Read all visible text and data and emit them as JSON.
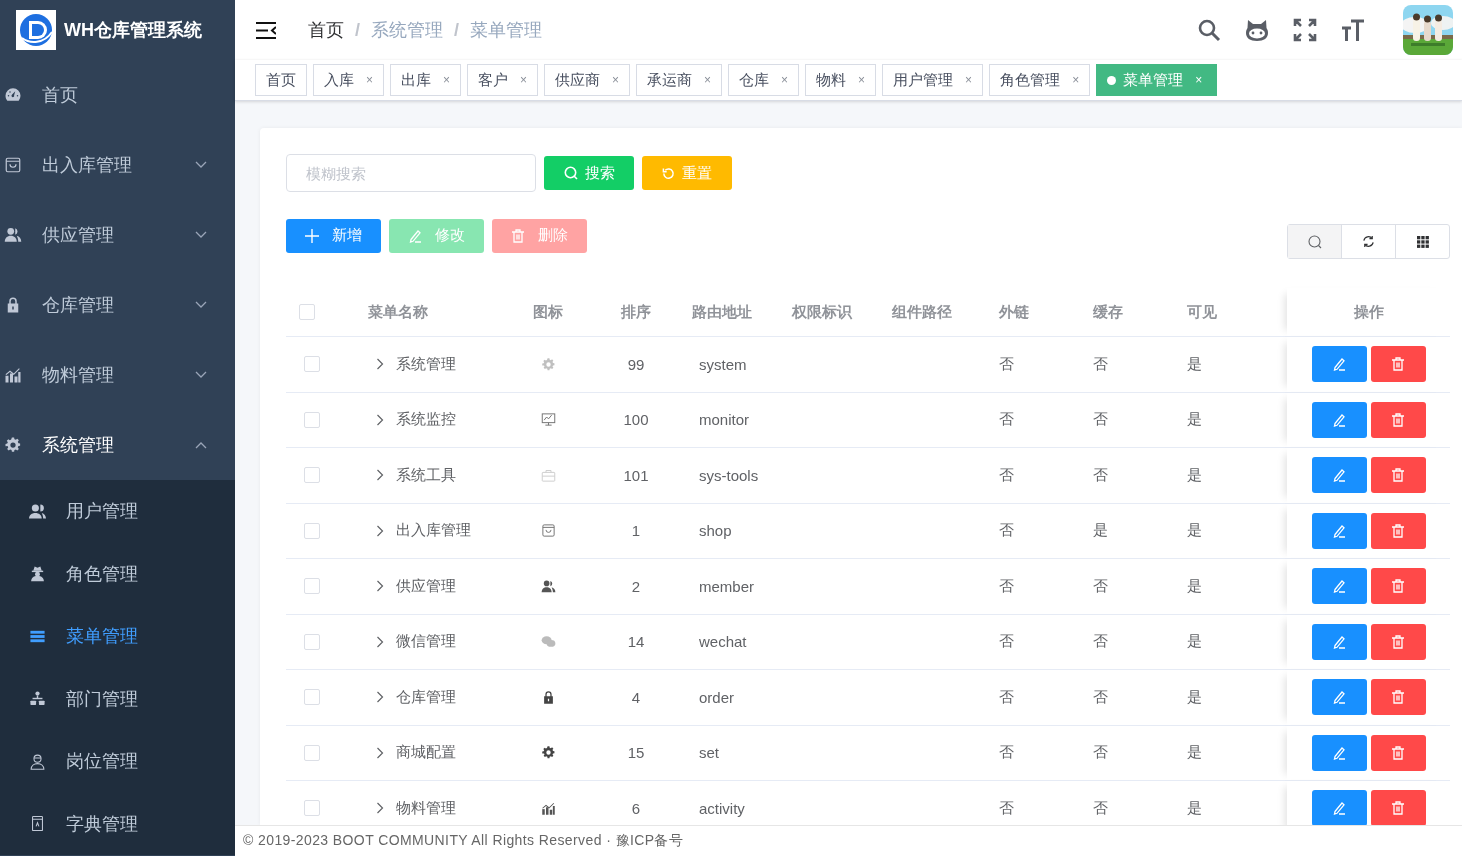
{
  "app": {
    "title": "WH仓库管理系统"
  },
  "sidebar": {
    "items": [
      {
        "label": "首页",
        "kind": "link"
      },
      {
        "label": "出入库管理",
        "kind": "group",
        "expanded": false
      },
      {
        "label": "供应管理",
        "kind": "group",
        "expanded": false
      },
      {
        "label": "仓库管理",
        "kind": "group",
        "expanded": false
      },
      {
        "label": "物料管理",
        "kind": "group",
        "expanded": false
      },
      {
        "label": "系统管理",
        "kind": "group",
        "expanded": true,
        "children": [
          {
            "label": "用户管理",
            "selected": false
          },
          {
            "label": "角色管理",
            "selected": false
          },
          {
            "label": "菜单管理",
            "selected": true
          },
          {
            "label": "部门管理",
            "selected": false
          },
          {
            "label": "岗位管理",
            "selected": false
          },
          {
            "label": "字典管理",
            "selected": false
          }
        ]
      }
    ]
  },
  "header": {
    "breadcrumb": [
      {
        "label": "首页",
        "link": true
      },
      {
        "separator": "/",
        "label": "系统管理",
        "link": false
      },
      {
        "separator": "/",
        "label": "菜单管理",
        "link": false
      }
    ]
  },
  "tags": [
    {
      "label": "首页",
      "selected": false
    },
    {
      "label": "入库",
      "close": "×",
      "selected": false
    },
    {
      "label": "出库",
      "close": "×",
      "selected": false
    },
    {
      "label": "客户",
      "close": "×",
      "selected": false
    },
    {
      "label": "供应商",
      "close": "×",
      "selected": false
    },
    {
      "label": "承运商",
      "close": "×",
      "selected": false
    },
    {
      "label": "仓库",
      "close": "×",
      "selected": false
    },
    {
      "label": "物料",
      "close": "×",
      "selected": false
    },
    {
      "label": "用户管理",
      "close": "×",
      "selected": false
    },
    {
      "label": "角色管理",
      "close": "×",
      "selected": false
    },
    {
      "label": "菜单管理",
      "close": "×",
      "selected": true
    }
  ],
  "search": {
    "placeholder": "模糊搜索",
    "buttons": [
      {
        "label": "搜索",
        "kind": "search"
      },
      {
        "label": "重置",
        "kind": "reset"
      }
    ]
  },
  "actions": [
    {
      "label": "新增",
      "kind": "add",
      "disabled": false
    },
    {
      "label": "修改",
      "kind": "edit",
      "disabled": true
    },
    {
      "label": "删除",
      "kind": "delete",
      "disabled": true
    }
  ],
  "table": {
    "header_checked": false,
    "columns": [
      "菜单名称",
      "图标",
      "排序",
      "路由地址",
      "权限标识",
      "组件路径",
      "外链",
      "缓存",
      "可见",
      "操作"
    ],
    "rows": [
      {
        "checked": false,
        "expanded": false,
        "name": "系统管理",
        "sort": "99",
        "path": "system",
        "external": "否",
        "cache": "否",
        "visible": "是"
      },
      {
        "checked": false,
        "expanded": false,
        "name": "系统监控",
        "sort": "100",
        "path": "monitor",
        "external": "否",
        "cache": "否",
        "visible": "是"
      },
      {
        "checked": false,
        "expanded": false,
        "name": "系统工具",
        "sort": "101",
        "path": "sys-tools",
        "external": "否",
        "cache": "否",
        "visible": "是"
      },
      {
        "checked": false,
        "expanded": false,
        "name": "出入库管理",
        "sort": "1",
        "path": "shop",
        "external": "否",
        "cache": "是",
        "visible": "是"
      },
      {
        "checked": false,
        "expanded": false,
        "name": "供应管理",
        "sort": "2",
        "path": "member",
        "external": "否",
        "cache": "否",
        "visible": "是"
      },
      {
        "checked": false,
        "expanded": false,
        "name": "微信管理",
        "sort": "14",
        "path": "wechat",
        "external": "否",
        "cache": "否",
        "visible": "是"
      },
      {
        "checked": false,
        "expanded": false,
        "name": "仓库管理",
        "sort": "4",
        "path": "order",
        "external": "否",
        "cache": "否",
        "visible": "是"
      },
      {
        "checked": false,
        "expanded": false,
        "name": "商城配置",
        "sort": "15",
        "path": "set",
        "external": "否",
        "cache": "否",
        "visible": "是"
      },
      {
        "checked": false,
        "expanded": false,
        "name": "物料管理",
        "sort": "6",
        "path": "activity",
        "external": "否",
        "cache": "否",
        "visible": "是"
      }
    ]
  },
  "footer": {
    "text": "© 2019-2023 BOOT COMMUNITY All Rights Reserved · 豫ICP备号"
  }
}
